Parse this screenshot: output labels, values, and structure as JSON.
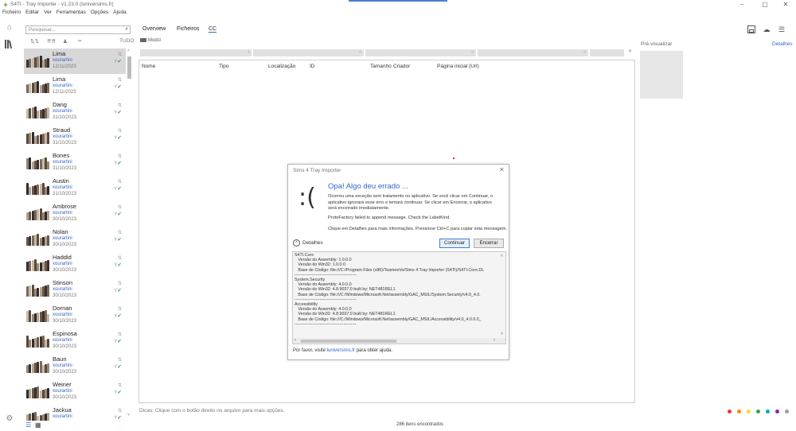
{
  "window": {
    "title": "S4TI - Tray Importer - v1.23.0 (luniversims.fr)",
    "controls": [
      "–",
      "▢",
      "✕"
    ]
  },
  "menu": [
    "Ficheiro",
    "Editar",
    "Ver",
    "Ferramentas",
    "Opções",
    "Ajuda"
  ],
  "search": {
    "placeholder": "Pesquisar..."
  },
  "filters": {
    "all_label": "TUDO",
    "icons": [
      "⇅⇅",
      "⇈⇈",
      "♟",
      "∞"
    ]
  },
  "tabs": [
    "Overview",
    "Ficheiros",
    "CC"
  ],
  "active_tab": "CC",
  "path": "Mods\\",
  "columns": [
    "Nome",
    "Tipo",
    "Localização",
    "ID",
    "Tamanho",
    "Criador",
    "Página inicial (Url)"
  ],
  "preview": {
    "label": "Pré-visualizar",
    "details_link": "Detalhes"
  },
  "tray_items": [
    {
      "name": "Lima",
      "author": "xourartini",
      "date": "12/11/2023",
      "selected": true
    },
    {
      "name": "Lima",
      "author": "xourartini",
      "date": "12/11/2023"
    },
    {
      "name": "Dang",
      "author": "xourartini",
      "date": "31/10/2023"
    },
    {
      "name": "Straud",
      "author": "xourartini",
      "date": "31/10/2023"
    },
    {
      "name": "Bones",
      "author": "xourartini",
      "date": "31/10/2023"
    },
    {
      "name": "Austin",
      "author": "xourartini",
      "date": "31/10/2023"
    },
    {
      "name": "Ambrose",
      "author": "xourartini",
      "date": "30/10/2023"
    },
    {
      "name": "Nolan",
      "author": "xourartini",
      "date": "30/10/2023"
    },
    {
      "name": "Haddid",
      "author": "xourartini",
      "date": "30/10/2023"
    },
    {
      "name": "Stinson",
      "author": "xourartini",
      "date": "30/10/2023"
    },
    {
      "name": "Dornan",
      "author": "xourartini",
      "date": "30/10/2023"
    },
    {
      "name": "Espinosa",
      "author": "xourartini",
      "date": "30/10/2023"
    },
    {
      "name": "Baun",
      "author": "xourartini",
      "date": "30/10/2023"
    },
    {
      "name": "Weiner",
      "author": "xourartini",
      "date": "30/10/2023"
    },
    {
      "name": "Jackua",
      "author": "xourartini",
      "date": ""
    }
  ],
  "hint": "Dicas: Clique com o botão direito no arquivo para mais opções.",
  "status": {
    "count": "286 itens encontrados"
  },
  "color_dots": [
    "#e53935",
    "#fb8c00",
    "#fdd835",
    "#43a047",
    "#00acc1",
    "#8e24aa",
    "#9e9e9e"
  ],
  "dialog": {
    "title": "Sims 4 Tray Importer",
    "close": "✕",
    "sad_face": ":(",
    "heading": "Opa! Algo deu errado ...",
    "message": "Ocorreu uma exceção sem tratamento no aplicativo. Se você clicar em Continuar, o aplicativo ignorará esse erro e tentará continuar. Se clicar em Encerrar, o aplicativo será encerrado imediatamente.",
    "error": "ProtoFactory failed to append message. Check the LabelKind.",
    "click_info": "Clique em Detalhes para mais informações. Pressione Ctrl+C para copiar esta mensagem.",
    "details_label": "Detalhes",
    "continue_label": "Continuar",
    "exit_label": "Encerrar",
    "log": "S4TI.Core\n   Versão do Assembly: 1.0.0.0\n   Versão do Win32: 1.0.0.0\n   Base de Código: file:///C:/Program Files (x86)/TeameeVo/Sims 4 Tray Importer (S4TI)/S4TI.Core.DL\n--------------------------------------------\nSystem.Security\n   Versão do Assembly: 4.0.0.0\n   Versão do Win32: 4.8.9037.0 built by: NET481REL1\n   Base de Código: file:///C:/Windows/Microsoft.Net/assembly/GAC_MSIL/System.Security/v4.0_4.0.\n--------------------------------------------\nAccessibility\n   Versão do Assembly: 4.0.0.0\n   Versão do Win32: 4.8.9037.0 built by: NET481REL1\n   Base de Código: file:///C:/Windows/Microsoft.Net/assembly/GAC_MSIL/Accessibility/v4.0_4.0.0.0_\n--------------------------------------------",
    "footer_prefix": "Por favor, visite ",
    "footer_link": "luniversims.fr",
    "footer_suffix": " para obter ajuda."
  }
}
